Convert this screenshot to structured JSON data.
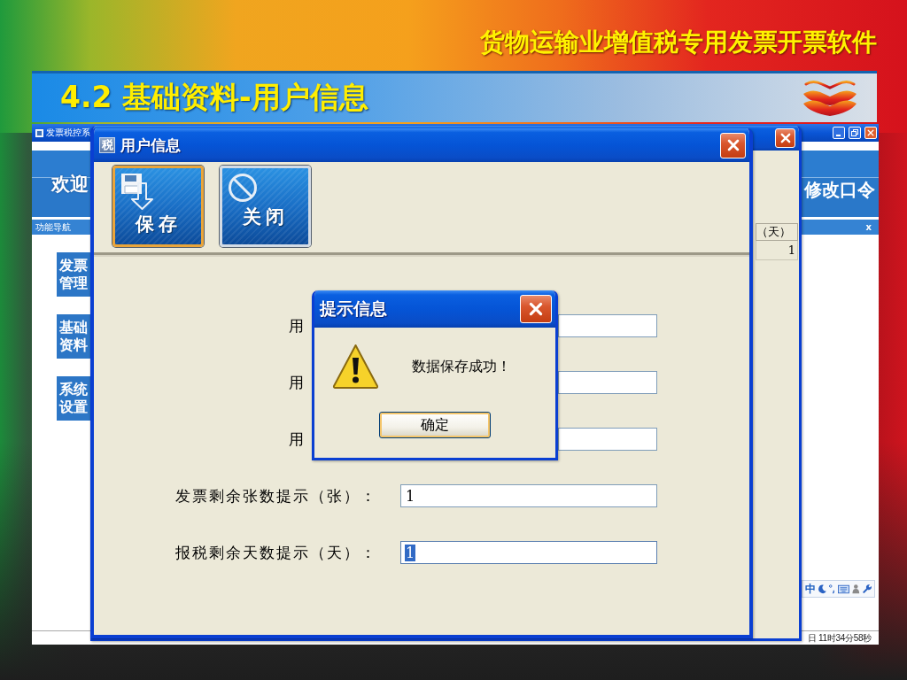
{
  "slide": {
    "header_title": "货物运输业增值税专用发票开票软件",
    "section_title": "4.2 基础资料-用户信息"
  },
  "main_window": {
    "title": "发票税控系",
    "welcome": "欢迎",
    "change_password": "修改口令",
    "nav_title": "功能导航",
    "nav_close": "x",
    "nav_items": [
      {
        "label": "发票管理"
      },
      {
        "label": "基础资料"
      },
      {
        "label": "系统设置"
      }
    ],
    "tray_ime": "中",
    "status_time": "日 11时34分58秒"
  },
  "background_window": {
    "table": {
      "columns": [
        "（天）"
      ],
      "rows": [
        [
          "1"
        ]
      ]
    }
  },
  "user_info_window": {
    "title_icon": "税",
    "title": "用户信息",
    "toolbar": [
      {
        "label": "保存",
        "kind": "save",
        "focused": true
      },
      {
        "label": "关闭",
        "kind": "close",
        "focused": false
      }
    ],
    "fields": [
      {
        "label": "用",
        "kind": "covered",
        "focused": false
      },
      {
        "label": "用",
        "kind": "covered",
        "focused": false
      },
      {
        "label": "用",
        "kind": "covered",
        "focused": false
      },
      {
        "label": "发票剩余张数提示（张）：",
        "kind": "full",
        "value": "1",
        "focused": false
      },
      {
        "label": "报税剩余天数提示（天）：",
        "kind": "full",
        "value": "1",
        "focused": true
      }
    ]
  },
  "message_dialog": {
    "title": "提示信息",
    "message": "数据保存成功！",
    "button": "确定"
  }
}
